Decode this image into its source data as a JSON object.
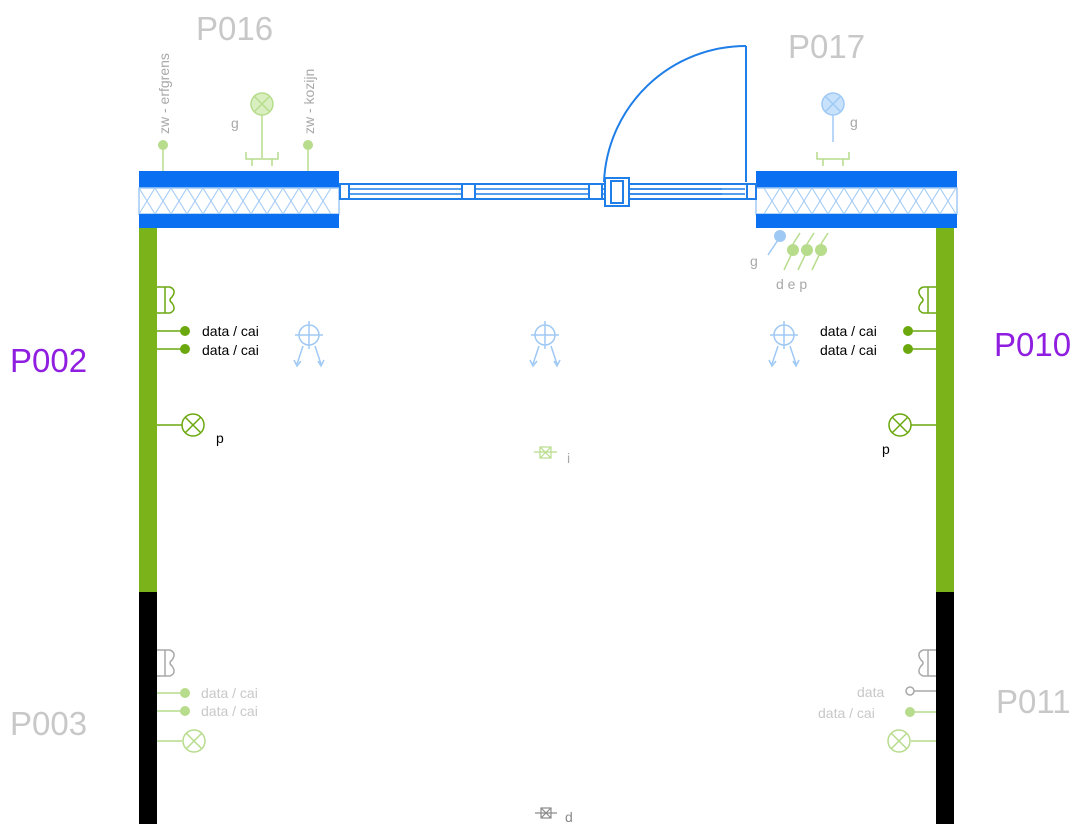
{
  "colors": {
    "wall_blue": "#0a6ff0",
    "outline_blue": "#1f7ee8",
    "wall_green": "#7ab31a",
    "wall_black": "#000000",
    "active_room": "#8f1ee0",
    "faded_room": "#c8c8c8",
    "faded_green": "#b7dc8c",
    "faded_blue": "#9fc9f5",
    "symbol_green": "#6aa80e",
    "faded_gray": "#a8a8a8"
  },
  "rooms": {
    "p016": "P016",
    "p017": "P017",
    "p002": "P002",
    "p010": "P010",
    "p003": "P003",
    "p011": "P011"
  },
  "labels": {
    "erfgrens": "zw - erfgrens",
    "kozijn": "zw - kozijn",
    "g": "g",
    "dep": "d e p",
    "data_cai": "data / cai",
    "data": "data",
    "p": "p",
    "i": "i",
    "d": "d"
  }
}
